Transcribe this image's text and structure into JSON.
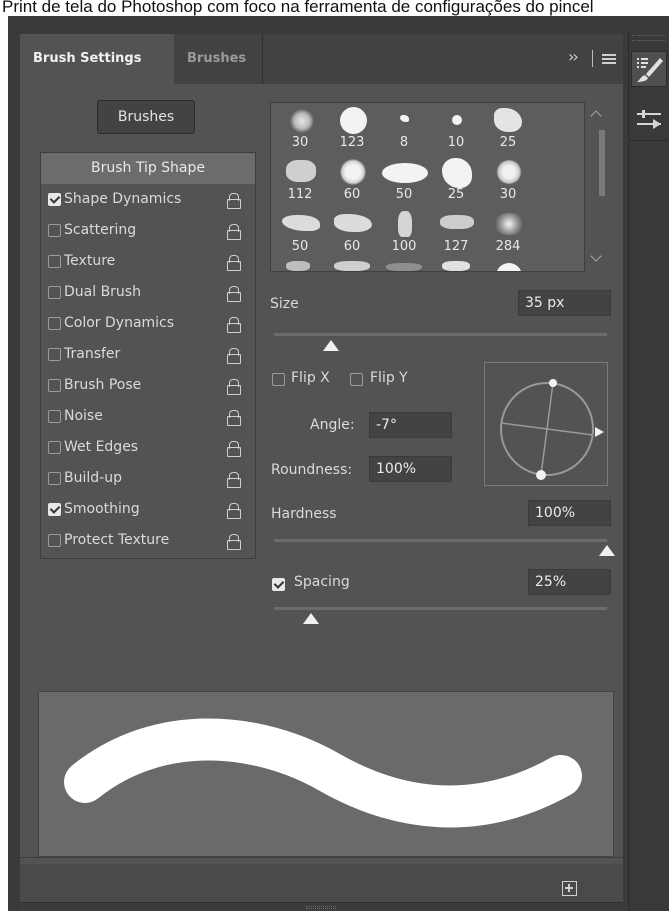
{
  "caption": "Print de tela do Photoshop com foco na ferramenta de configurações do pincel",
  "tabs": {
    "brush_settings": "Brush Settings",
    "brushes": "Brushes"
  },
  "brushes_button": "Brushes",
  "options": [
    {
      "label": "Brush Tip Shape",
      "selected": true
    },
    {
      "label": "Shape Dynamics",
      "checked": true
    },
    {
      "label": "Scattering",
      "checked": false
    },
    {
      "label": "Texture",
      "checked": false
    },
    {
      "label": "Dual Brush",
      "checked": false
    },
    {
      "label": "Color Dynamics",
      "checked": false
    },
    {
      "label": "Transfer",
      "checked": false
    },
    {
      "label": "Brush Pose",
      "checked": false
    },
    {
      "label": "Noise",
      "checked": false
    },
    {
      "label": "Wet Edges",
      "checked": false
    },
    {
      "label": "Build-up",
      "checked": false
    },
    {
      "label": "Smoothing",
      "checked": true
    },
    {
      "label": "Protect Texture",
      "checked": false
    }
  ],
  "brush_tips": [
    "30",
    "123",
    "8",
    "10",
    "25",
    "112",
    "60",
    "50",
    "25",
    "30",
    "50",
    "60",
    "100",
    "127",
    "284"
  ],
  "size": {
    "label": "Size",
    "value": "35 px"
  },
  "flip_x": {
    "label": "Flip X",
    "checked": false
  },
  "flip_y": {
    "label": "Flip Y",
    "checked": false
  },
  "angle": {
    "label": "Angle:",
    "value": "-7°"
  },
  "roundness": {
    "label": "Roundness:",
    "value": "100%"
  },
  "hardness": {
    "label": "Hardness",
    "value": "100%"
  },
  "spacing": {
    "label": "Spacing",
    "value": "25%",
    "checked": true
  },
  "slider_levels": {
    "size": 0.17,
    "hardness": 1.0,
    "spacing": 0.11
  },
  "icons": {
    "brush": "brush-settings-icon",
    "presets": "brush-presets-icon",
    "new": "new-preset-icon"
  }
}
